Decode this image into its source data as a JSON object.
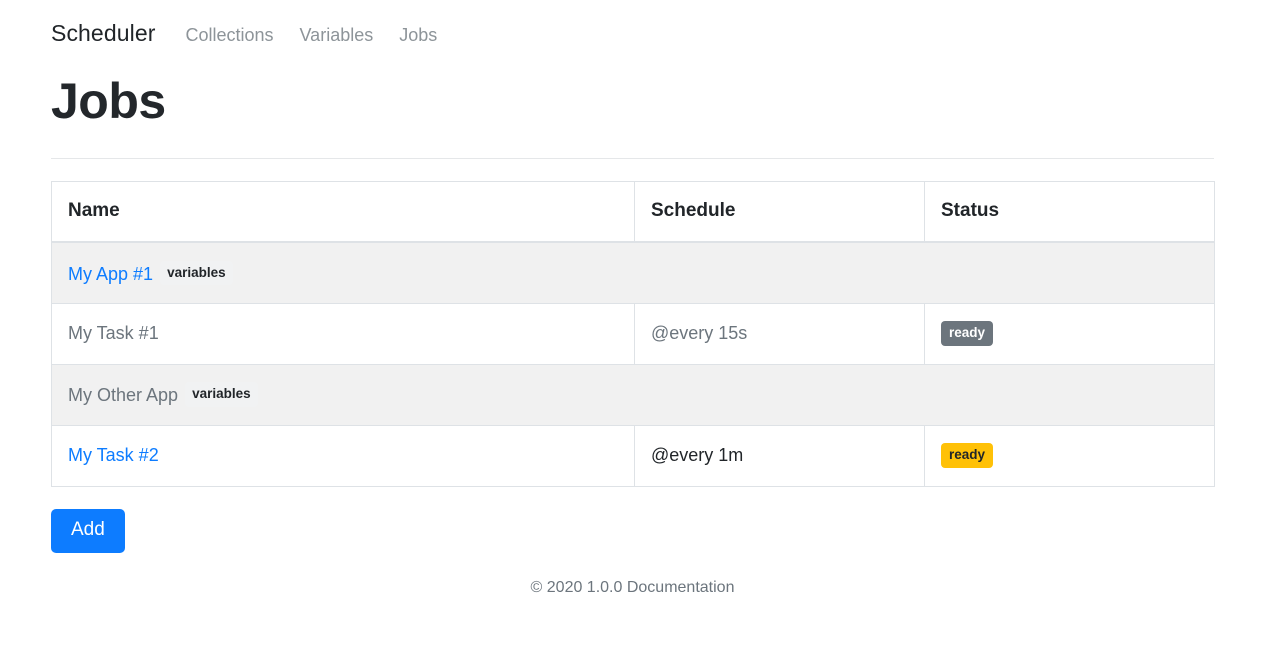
{
  "navbar": {
    "brand": "Scheduler",
    "links": [
      {
        "label": "Collections"
      },
      {
        "label": "Variables"
      },
      {
        "label": "Jobs"
      }
    ]
  },
  "page": {
    "title": "Jobs"
  },
  "table": {
    "columns": {
      "name": "Name",
      "schedule": "Schedule",
      "status": "Status"
    },
    "rows": [
      {
        "type": "group",
        "name": "My App #1",
        "name_style": "link",
        "badge": "variables",
        "schedule": "",
        "status": ""
      },
      {
        "type": "task",
        "name": "My Task #1",
        "name_style": "muted",
        "schedule": "@every 15s",
        "schedule_style": "muted",
        "status": "ready",
        "status_variant": "secondary"
      },
      {
        "type": "group",
        "name": "My Other App",
        "name_style": "muted",
        "badge": "variables",
        "schedule": "",
        "status": ""
      },
      {
        "type": "task",
        "name": "My Task #2",
        "name_style": "link",
        "schedule": "@every 1m",
        "schedule_style": "dark",
        "status": "ready",
        "status_variant": "warning"
      }
    ]
  },
  "actions": {
    "add_label": "Add"
  },
  "footer": {
    "copyright": "© 2020 1.0.0",
    "doc_link": "Documentation"
  },
  "colors": {
    "link": "#0d7cff",
    "muted": "#6c757d",
    "warning": "#ffc107",
    "secondary": "#6c757d",
    "group_row_bg": "#f1f1f1",
    "border": "#dee2e6"
  }
}
